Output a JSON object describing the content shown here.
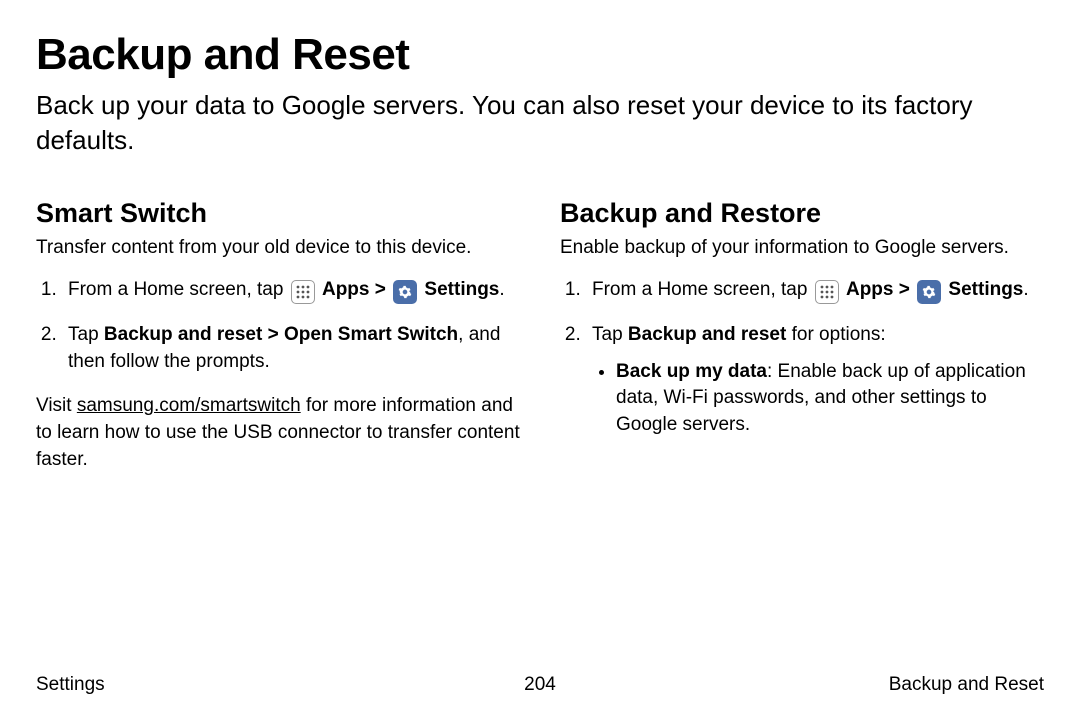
{
  "title": "Backup and Reset",
  "intro": "Back up your data to Google servers. You can also reset your device to its factory defaults.",
  "left": {
    "heading": "Smart Switch",
    "desc": "Transfer content from your old device to this device.",
    "step1_a": "From a Home screen, tap ",
    "step1_apps": "Apps",
    "step1_sep": " > ",
    "step1_settings": "Settings",
    "step1_end": ".",
    "step2_a": "Tap ",
    "step2_bold": "Backup and reset > Open Smart Switch",
    "step2_b": ", and then follow the prompts.",
    "note_a": "Visit ",
    "note_link": "samsung.com/smartswitch",
    "note_b": " for more information and to learn how to use the USB connector to transfer content faster."
  },
  "right": {
    "heading": "Backup and Restore",
    "desc": "Enable backup of your information to Google servers.",
    "step1_a": "From a Home screen, tap ",
    "step1_apps": "Apps",
    "step1_sep": " > ",
    "step1_settings": "Settings",
    "step1_end": ".",
    "step2_a": "Tap ",
    "step2_bold": "Backup and reset",
    "step2_b": " for options:",
    "bullet1_bold": "Back up my data",
    "bullet1_rest": ": Enable back up of application data, Wi-Fi passwords, and other settings to Google servers."
  },
  "footer": {
    "left": "Settings",
    "center": "204",
    "right": "Backup and Reset"
  }
}
